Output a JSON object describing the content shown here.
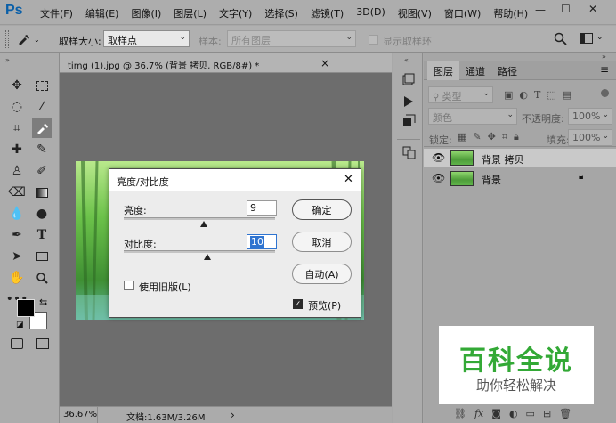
{
  "app": {
    "logo": "Ps"
  },
  "menubar": {
    "items": [
      "文件(F)",
      "编辑(E)",
      "图像(I)",
      "图层(L)",
      "文字(Y)",
      "选择(S)",
      "滤镜(T)",
      "3D(D)",
      "视图(V)",
      "窗口(W)",
      "帮助(H)"
    ],
    "min": "—",
    "max": "☐",
    "close": "✕"
  },
  "options": {
    "sample_size_label": "取样大小:",
    "sample_size_value": "取样点",
    "sample_label": "样本:",
    "sample_value": "所有图层",
    "show_ring_label": "显示取样环"
  },
  "document": {
    "tab_title": "timg (1).jpg @ 36.7% (背景 拷贝, RGB/8#) *",
    "close": "×",
    "zoom": "36.67%",
    "doc_size": "文档:1.63M/3.26M",
    "arrow": "›"
  },
  "dialog": {
    "title": "亮度/对比度",
    "close": "✕",
    "brightness_label": "亮度:",
    "brightness_value": "9",
    "brightness_fraction": 0.53,
    "contrast_label": "对比度:",
    "contrast_value": "10",
    "contrast_fraction": 0.55,
    "legacy_label": "使用旧版(L)",
    "legacy_checked": false,
    "ok": "确定",
    "cancel": "取消",
    "auto": "自动(A)",
    "preview_label": "预览(P)",
    "preview_checked": true
  },
  "layers_panel": {
    "tabs": [
      "图层",
      "通道",
      "路径"
    ],
    "kind_filter": "类型",
    "blend_mode": "颜色",
    "opacity_label": "不透明度:",
    "opacity_value": "100%",
    "lock_label": "锁定:",
    "fill_label": "填充:",
    "fill_value": "100%",
    "layers": [
      {
        "name": "背景 拷贝",
        "selected": true,
        "locked": false
      },
      {
        "name": "背景",
        "selected": false,
        "locked": true
      }
    ]
  },
  "watermark": {
    "title": "百科全说",
    "subtitle": "助你轻松解决"
  },
  "colors": {
    "accent_blue": "#0a5fa8",
    "watermark_green": "#33a936",
    "selection_blue": "#2f74d0"
  }
}
